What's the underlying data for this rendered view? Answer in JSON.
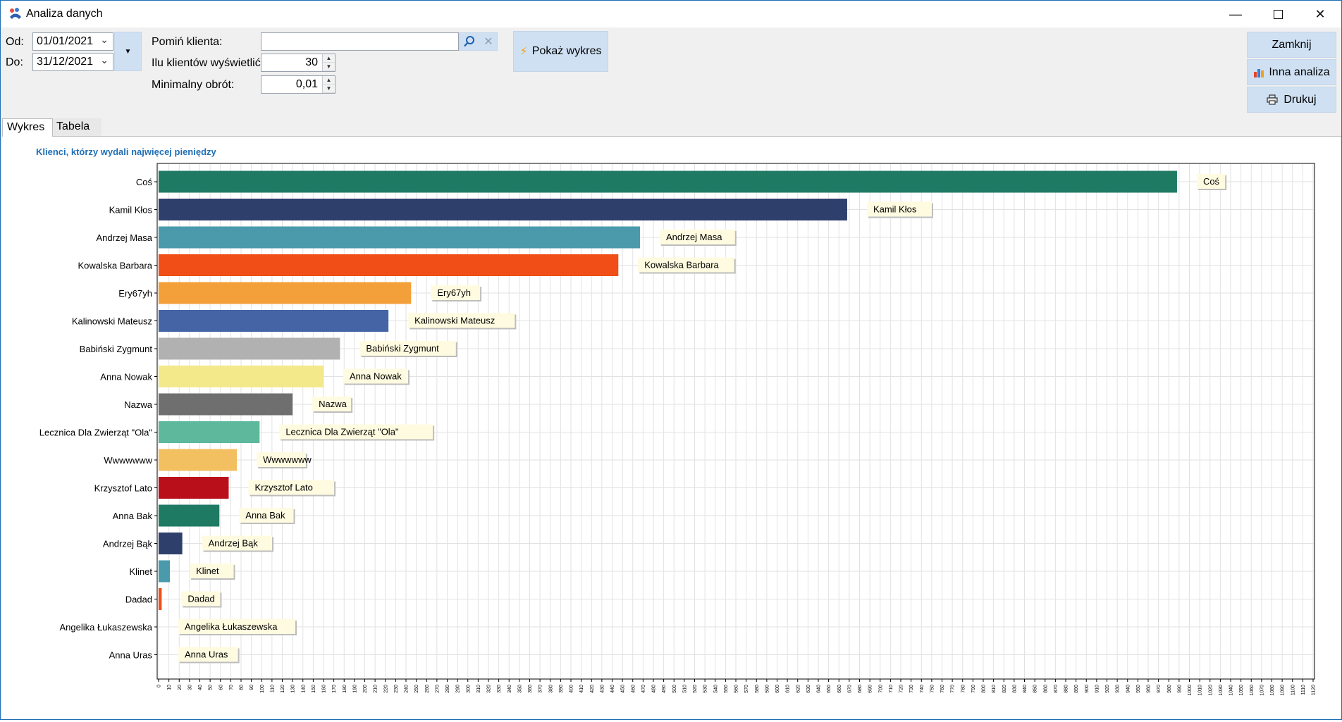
{
  "window": {
    "title": "Analiza danych"
  },
  "filters": {
    "from_label": "Od:",
    "from_value": "01/01/2021",
    "to_label": "Do:",
    "to_value": "31/12/2021",
    "skip_client_label": "Pomiń klienta:",
    "skip_client_value": "",
    "count_label": "Ilu klientów wyświetlić:",
    "count_value": "30",
    "min_turnover_label": "Minimalny obrót:",
    "min_turnover_value": "0,01"
  },
  "buttons": {
    "show_chart": "Pokaż wykres",
    "close": "Zamknij",
    "other_analysis": "Inna analiza",
    "print": "Drukuj"
  },
  "tabs": [
    {
      "label": "Wykres",
      "active": true
    },
    {
      "label": "Tabela",
      "active": false
    }
  ],
  "chart_data": {
    "type": "bar",
    "orientation": "horizontal",
    "title": "Klienci, którzy wydali najwięcej pieniędzy",
    "xlim": [
      0,
      1120
    ],
    "x_tick_step": 10,
    "grid": true,
    "categories": [
      "Coś",
      "Kamil Kłos",
      "Andrzej Masa",
      "Kowalska Barbara",
      "Ery67yh",
      "Kalinowski Mateusz",
      "Babiński Zygmunt",
      "Anna Nowak",
      "Nazwa",
      "Lecznica Dla Zwierząt \"Ola\"",
      "Wwwwwww",
      "Krzysztof Lato",
      "Anna Bak",
      "Andrzej Bąk",
      "Klinet",
      "Dadad",
      "Angelika Łukaszewska",
      "Anna Uras"
    ],
    "values": [
      988,
      668,
      467,
      446,
      245,
      223,
      176,
      160,
      130,
      98,
      76,
      68,
      59,
      23,
      11,
      3,
      0,
      0
    ],
    "colors": [
      "#1f7a64",
      "#2e3f6b",
      "#4a9aab",
      "#f04e16",
      "#f3a03a",
      "#4464a6",
      "#b1b1b1",
      "#f3e98b",
      "#6f6f6f",
      "#5db89c",
      "#f3c061",
      "#b80f1a",
      "#1f7a64",
      "#2e3f6b",
      "#4a9aab",
      "#f04e16",
      "#f3a03a",
      "#4464a6"
    ]
  }
}
